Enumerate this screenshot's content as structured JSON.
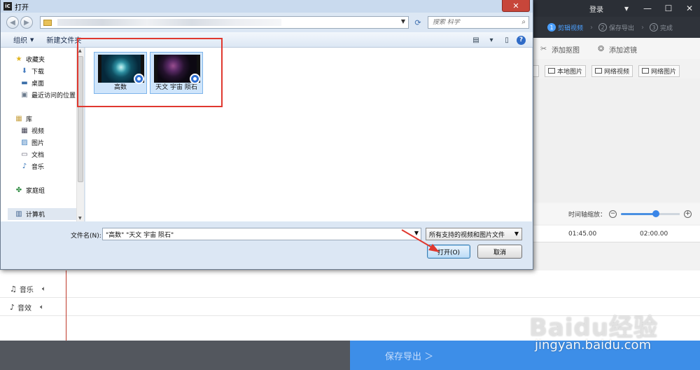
{
  "app": {
    "login": "登录",
    "steps": [
      {
        "num": "1",
        "label": "剪辑视频"
      },
      {
        "num": "2",
        "label": "保存导出"
      },
      {
        "num": "3",
        "label": "完成"
      }
    ],
    "tools": {
      "add_matting": "添加抠图",
      "add_filter": "添加滤镜"
    },
    "media_buttons": [
      "本地图片",
      "网络视频",
      "网络图片"
    ],
    "zoom_label": "时间轴缩放：",
    "zoom_level": 0.6,
    "ruler": [
      "01:45.00",
      "02:00.00"
    ],
    "tracks": [
      {
        "name": "音乐",
        "icon": "music-note-icon"
      },
      {
        "name": "音效",
        "icon": "sound-effect-icon"
      }
    ],
    "export_button": "保存导出 ＞",
    "watermark": {
      "logo": "Baidu经验",
      "url": "jingyan.baidu.com"
    },
    "colors": {
      "accent": "#3d8ee8",
      "titlebar": "#2b2f36",
      "annotation": "#e0382f"
    }
  },
  "dialog": {
    "title": "打开",
    "close": "✕",
    "search_placeholder": "搜索 科学",
    "toolbar": {
      "organize": "组织",
      "new_folder": "新建文件夹"
    },
    "nav": {
      "favorites": "收藏夹",
      "downloads": "下载",
      "desktop": "桌面",
      "recent": "最近访问的位置",
      "libraries": "库",
      "videos": "视频",
      "pictures": "图片",
      "documents": "文档",
      "music": "音乐",
      "homegroup": "家庭组",
      "computer": "计算机"
    },
    "files": [
      {
        "name": "高数"
      },
      {
        "name": "天文 宇宙 陨石"
      }
    ],
    "filename_label": "文件名(N):",
    "filename_value": "\"高数\" \"天文 宇宙 陨石\"",
    "filetype_value": "所有支持的视频和图片文件",
    "open_button": "打开(O)",
    "cancel_button": "取消"
  }
}
